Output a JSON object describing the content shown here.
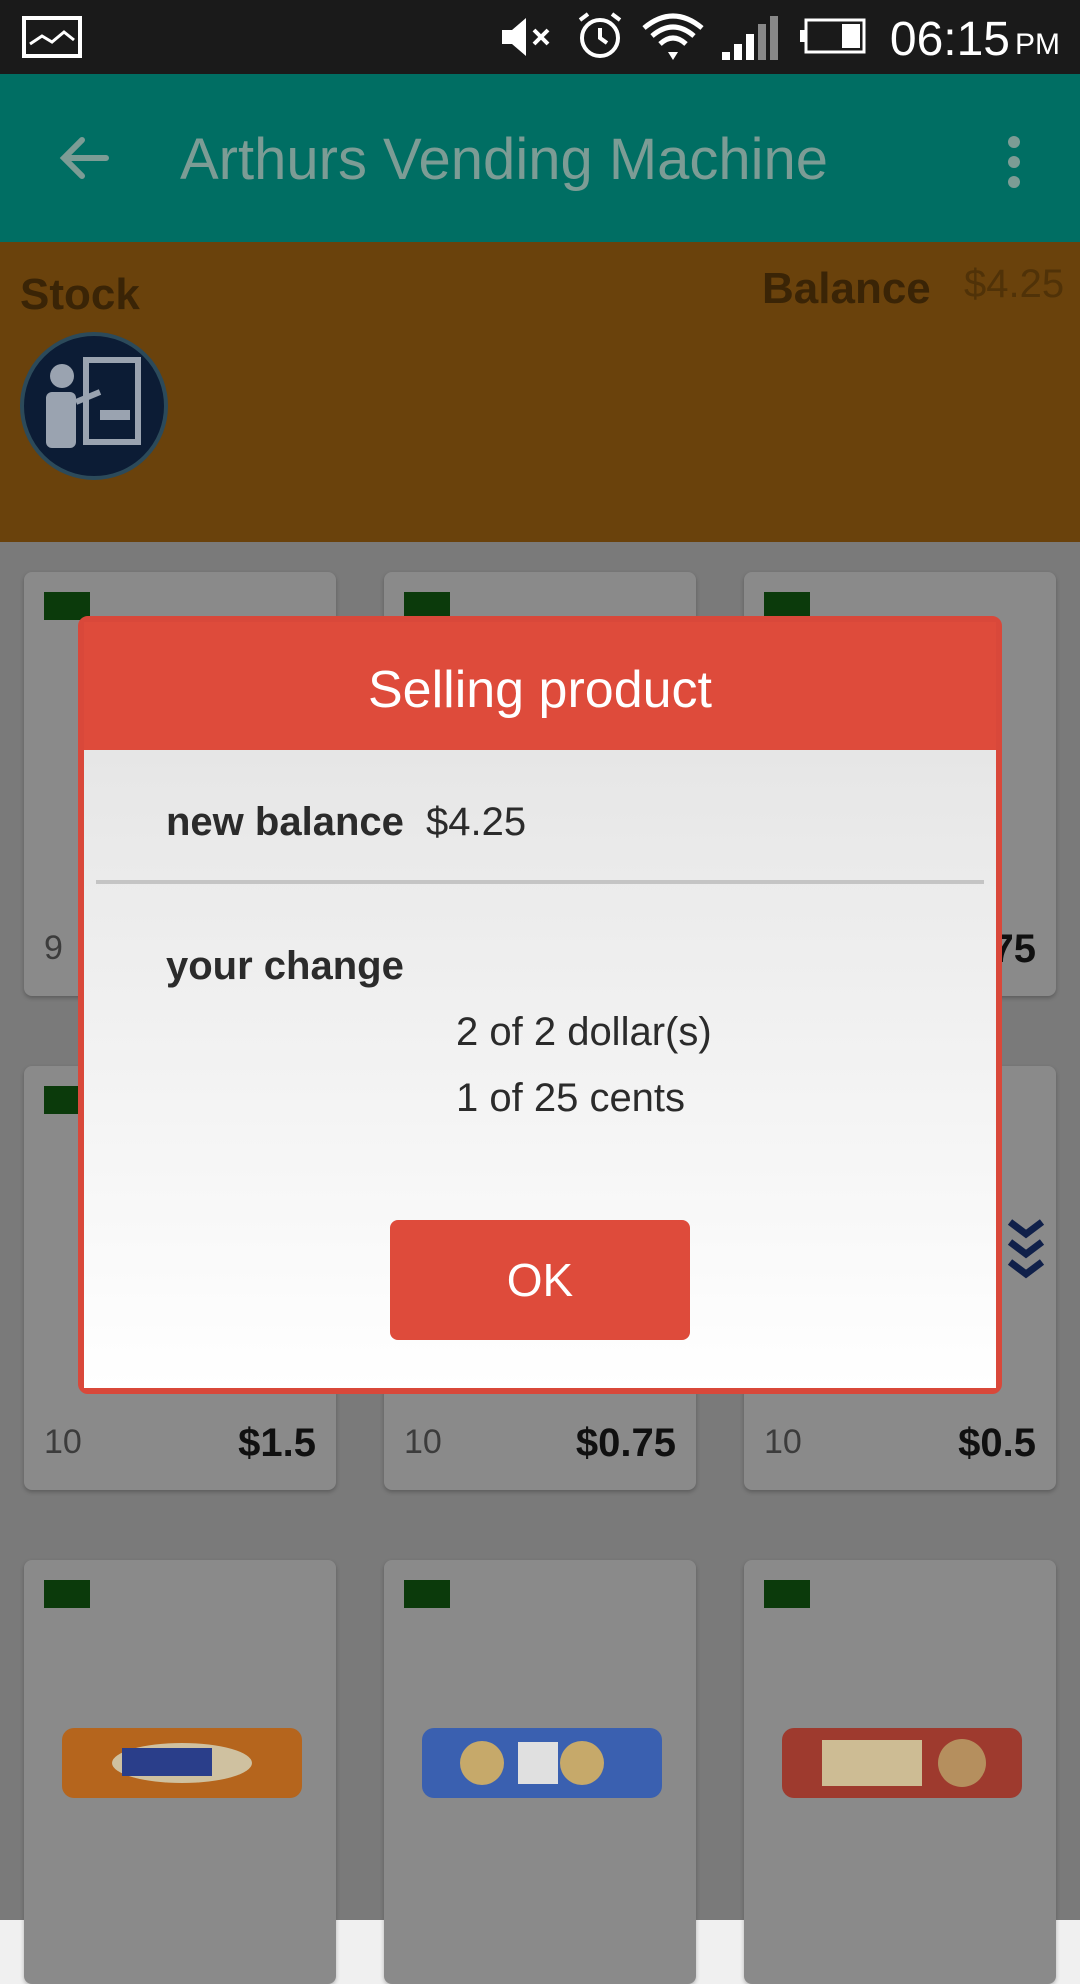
{
  "status_bar": {
    "time": "06:15",
    "ampm": "PM",
    "icons": [
      "gallery-icon",
      "mute-icon",
      "alarm-icon",
      "wifi-icon",
      "signal-icon",
      "battery-icon"
    ]
  },
  "app_bar": {
    "title": "Arthurs Vending Machine",
    "back_icon": "arrow-left-icon",
    "more_icon": "more-vert-icon",
    "background": "#006e63"
  },
  "header": {
    "stock_label": "Stock",
    "balance_label": "Balance",
    "balance_value": "$4.25"
  },
  "products": [
    {
      "count": "9",
      "price": ""
    },
    {
      "count": "",
      "price": ""
    },
    {
      "count": "",
      "price": "75"
    },
    {
      "count": "10",
      "price": "$1.5"
    },
    {
      "count": "10",
      "price": "$0.75"
    },
    {
      "count": "10",
      "price": "$0.5"
    },
    {
      "count": "",
      "price": ""
    },
    {
      "count": "",
      "price": ""
    },
    {
      "count": "",
      "price": ""
    }
  ],
  "dialog": {
    "title": "Selling product",
    "new_balance_label": "new balance",
    "new_balance_value": "$4.25",
    "change_label": "your change",
    "change_lines": [
      "2 of 2 dollar(s)",
      "1 of 25 cents"
    ],
    "ok_label": "OK",
    "accent": "#de4b3b"
  }
}
